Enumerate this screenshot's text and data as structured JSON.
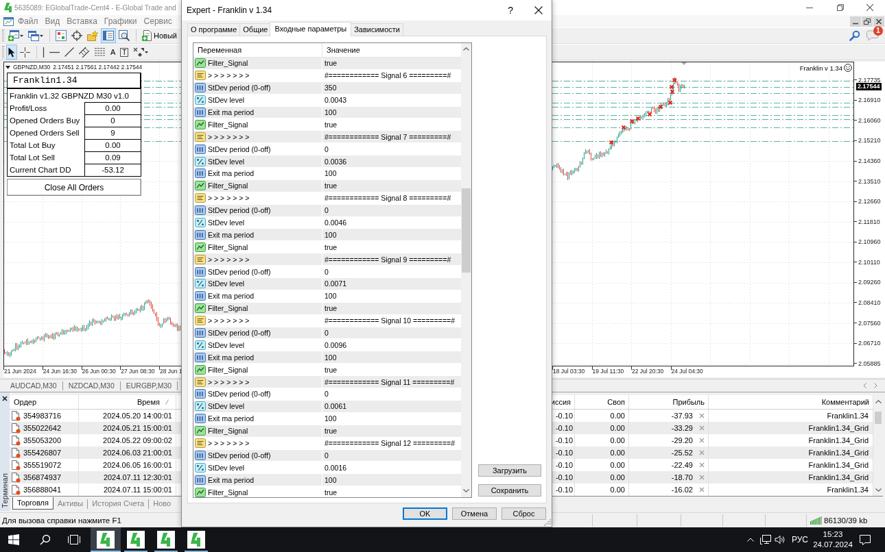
{
  "app_window": {
    "title": "5635089: EGlobalTrade-Cent4 - E-Global Trade and",
    "menu": [
      "Файл",
      "Вид",
      "Вставка",
      "Графики",
      "Сервис"
    ],
    "notification_count": "1"
  },
  "toolbars": [
    {
      "groups": [
        [
          {
            "kind": "new_chart",
            "pressed": false
          },
          {
            "kind": "profiles",
            "pressed": false
          }
        ],
        [
          {
            "kind": "market_watch",
            "pressed": false
          },
          {
            "kind": "navigator",
            "pressed": false
          },
          {
            "kind": "favorites",
            "pressed": false
          },
          {
            "kind": "terminal",
            "pressed": true
          },
          {
            "kind": "tester",
            "pressed": false
          }
        ],
        [
          {
            "kind": "new_order",
            "label": "Новый",
            "pressed": false
          }
        ]
      ]
    },
    {
      "groups": [
        [
          {
            "kind": "cursor",
            "pressed": true
          },
          {
            "kind": "crosshair",
            "pressed": false
          }
        ],
        [
          {
            "kind": "vertical_line",
            "pressed": false
          },
          {
            "kind": "horizontal_line",
            "pressed": false
          },
          {
            "kind": "trendline",
            "pressed": false
          },
          {
            "kind": "channel",
            "pressed": false
          },
          {
            "kind": "fibonacci",
            "pressed": false
          },
          {
            "kind": "text",
            "label": "A",
            "pressed": false
          },
          {
            "kind": "text_label",
            "label": "T",
            "pressed": false
          },
          {
            "kind": "arrows",
            "pressed": false
          }
        ]
      ]
    }
  ],
  "chart": {
    "symbol": "GBPNZD,M30",
    "ohlc_text": "2.17451 2.17561 2.17442 2.17544",
    "expert_label": "Franklin v 1.34",
    "current_price": "2.17544",
    "price_labels": [
      "2.17735",
      "2.16910",
      "2.16060",
      "2.15210",
      "2.14360",
      "2.13510",
      "2.12660",
      "2.11810",
      "2.10960",
      "2.10110",
      "2.09260",
      "2.08410",
      "2.07560",
      "2.06710",
      "2.05885"
    ],
    "time_labels_left": [
      "21 Jun 2024",
      "24 Jun 16:30",
      "26 Jun 00:30",
      "27 Jun 08:30",
      "28 Jun 1"
    ],
    "time_labels_right": [
      "18 Jul 03:30",
      "19 Jul 11:30",
      "22 Jul 20:30",
      "24 Jul 04:30"
    ]
  },
  "info_panel": {
    "title": "Franklin1.34",
    "subtitle": "Franklin v1.32 GBPNZD M30 v1.0",
    "rows": [
      {
        "label": "Profit/Loss",
        "value": "0.00"
      },
      {
        "label": "Opened Orders Buy",
        "value": "0"
      },
      {
        "label": "Opened Orders Sell",
        "value": "9"
      },
      {
        "label": "Total Lot Buy",
        "value": "0.00"
      },
      {
        "label": "Total Lot Sell",
        "value": "0.09"
      },
      {
        "label": "Current Chart DD",
        "value": "-53.12"
      }
    ],
    "button": "Close All Orders"
  },
  "chart_tabs": [
    {
      "label": "AUDCAD,M30",
      "selected": false
    },
    {
      "label": "NZDCAD,M30",
      "selected": false
    },
    {
      "label": "EURGBP,M30",
      "selected": false
    }
  ],
  "terminal": {
    "label": "Терминал",
    "columns": [
      {
        "label": "Ордер",
        "sorted": false
      },
      {
        "label": "Время",
        "sorted": true
      },
      {
        "label": "иссия",
        "sorted": false
      },
      {
        "label": "Своп",
        "sorted": false
      },
      {
        "label": "Прибыль",
        "sorted": false
      },
      {
        "label": "Комментарий",
        "sorted": false
      }
    ],
    "rows": [
      [
        "354983716",
        "2024.05.20 14:00:01",
        "-0.10",
        "0.00",
        "-37.93",
        "Franklin1.34"
      ],
      [
        "355022642",
        "2024.05.21 15:00:01",
        "-0.10",
        "0.00",
        "-33.29",
        "Franklin1.34_Grid"
      ],
      [
        "355053200",
        "2024.05.22 09:00:02",
        "-0.10",
        "0.00",
        "-29.20",
        "Franklin1.34_Grid"
      ],
      [
        "355426807",
        "2024.06.03 21:00:01",
        "-0.10",
        "0.00",
        "-25.52",
        "Franklin1.34_Grid"
      ],
      [
        "355519072",
        "2024.06.05 16:00:01",
        "-0.10",
        "0.00",
        "-22.49",
        "Franklin1.34_Grid"
      ],
      [
        "356874937",
        "2024.07.11 12:30:01",
        "-0.10",
        "0.00",
        "-18.70",
        "Franklin1.34_Grid"
      ],
      [
        "356888041",
        "2024.07.11 15:00:01",
        "-0.10",
        "0.00",
        "-16.02",
        "Franklin1.34"
      ]
    ],
    "tabs": [
      {
        "label": "Торговля",
        "selected": true
      },
      {
        "label": "Активы",
        "selected": false
      },
      {
        "label": "История Счета",
        "selected": false
      },
      {
        "label": "Ново",
        "selected": false
      }
    ]
  },
  "status_bar": {
    "help": "Для вызова справки нажмите F1",
    "traffic": "86130/39 kb"
  },
  "dialog": {
    "title": "Expert - Franklin v 1.34",
    "help_button": "?",
    "tabs": [
      {
        "label": "О программе",
        "selected": false
      },
      {
        "label": "Общие",
        "selected": false
      },
      {
        "label": "Входные параметры",
        "selected": true
      },
      {
        "label": "Зависимости",
        "selected": false
      }
    ],
    "columns": [
      "Переменная",
      "Значение"
    ],
    "params": [
      {
        "kind": "bool",
        "name": "Filter_Signal",
        "value": "true"
      },
      {
        "kind": "string",
        "name": "> > > > > > >",
        "value": "#============ Signal 6 =========#"
      },
      {
        "kind": "int",
        "name": "StDev period (0-off)",
        "value": "350"
      },
      {
        "kind": "double",
        "name": "StDev level",
        "value": "0.0043"
      },
      {
        "kind": "int",
        "name": "Exit ma period",
        "value": "100"
      },
      {
        "kind": "bool",
        "name": "Filter_Signal",
        "value": "true"
      },
      {
        "kind": "string",
        "name": "> > > > > > >",
        "value": "#============ Signal 7 =========#"
      },
      {
        "kind": "int",
        "name": "StDev period (0-off)",
        "value": "0"
      },
      {
        "kind": "double",
        "name": "StDev level",
        "value": "0.0036"
      },
      {
        "kind": "int",
        "name": "Exit ma period",
        "value": "100"
      },
      {
        "kind": "bool",
        "name": "Filter_Signal",
        "value": "true"
      },
      {
        "kind": "string",
        "name": "> > > > > > >",
        "value": "#============ Signal 8 =========#"
      },
      {
        "kind": "int",
        "name": "StDev period (0-off)",
        "value": "0"
      },
      {
        "kind": "double",
        "name": "StDev level",
        "value": "0.0046"
      },
      {
        "kind": "int",
        "name": "Exit ma period",
        "value": "100"
      },
      {
        "kind": "bool",
        "name": "Filter_Signal",
        "value": "true"
      },
      {
        "kind": "string",
        "name": "> > > > > > >",
        "value": "#============ Signal 9 =========#"
      },
      {
        "kind": "int",
        "name": "StDev period (0-off)",
        "value": "0"
      },
      {
        "kind": "double",
        "name": "StDev level",
        "value": "0.0071"
      },
      {
        "kind": "int",
        "name": "Exit ma period",
        "value": "100"
      },
      {
        "kind": "bool",
        "name": "Filter_Signal",
        "value": "true"
      },
      {
        "kind": "string",
        "name": "> > > > > > >",
        "value": "#============ Signal 10 =========#"
      },
      {
        "kind": "int",
        "name": "StDev period (0-off)",
        "value": "0"
      },
      {
        "kind": "double",
        "name": "StDev level",
        "value": "0.0096"
      },
      {
        "kind": "int",
        "name": "Exit ma period",
        "value": "100"
      },
      {
        "kind": "bool",
        "name": "Filter_Signal",
        "value": "true"
      },
      {
        "kind": "string",
        "name": "> > > > > > >",
        "value": "#============ Signal 11 =========#"
      },
      {
        "kind": "int",
        "name": "StDev period (0-off)",
        "value": "0"
      },
      {
        "kind": "double",
        "name": "StDev level",
        "value": "0.0061"
      },
      {
        "kind": "int",
        "name": "Exit ma period",
        "value": "100"
      },
      {
        "kind": "bool",
        "name": "Filter_Signal",
        "value": "true"
      },
      {
        "kind": "string",
        "name": "> > > > > > >",
        "value": "#============ Signal 12 =========#"
      },
      {
        "kind": "int",
        "name": "StDev period (0-off)",
        "value": "0"
      },
      {
        "kind": "double",
        "name": "StDev level",
        "value": "0.0016"
      },
      {
        "kind": "int",
        "name": "Exit ma period",
        "value": "100"
      },
      {
        "kind": "bool",
        "name": "Filter_Signal",
        "value": "true"
      }
    ],
    "side_buttons": [
      "Загрузить",
      "Сохранить"
    ],
    "buttons": [
      {
        "label": "OK",
        "default": true
      },
      {
        "label": "Отмена",
        "default": false
      },
      {
        "label": "Сброс",
        "default": false
      }
    ]
  },
  "taskbar": {
    "apps": [
      {
        "active": true
      },
      {
        "active": false
      },
      {
        "active": false
      },
      {
        "active": false
      }
    ],
    "language": "РУС",
    "time": "15:23",
    "date": "24.07.2024"
  }
}
